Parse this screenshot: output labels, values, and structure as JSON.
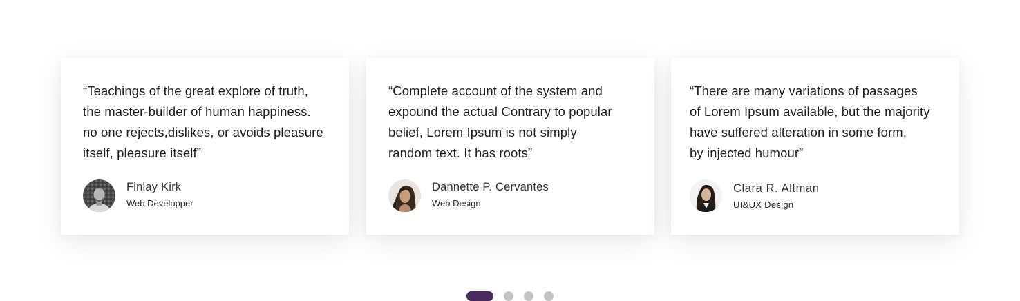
{
  "testimonials": [
    {
      "quote_lines": [
        "“Teachings of the great explore of truth,",
        "the master-builder of human happiness.",
        "no one rejects,dislikes, or avoids pleasure",
        "itself, pleasure itself”"
      ],
      "name": "Finlay Kirk",
      "role": "Web Developper"
    },
    {
      "quote_lines": [
        "“Complete account of the system and",
        "expound the actual Contrary to popular",
        "belief, Lorem Ipsum is not simply",
        "random text. It has roots”"
      ],
      "name": "Dannette P. Cervantes",
      "role": "Web Design"
    },
    {
      "quote_lines": [
        "“There are many variations of passages",
        " of Lorem Ipsum available, but the majority",
        " have suffered alteration in some form,",
        " by injected humour”"
      ],
      "name": "Clara R. Altman",
      "role": "UI&UX Design"
    }
  ],
  "pagination": {
    "active_index": 0,
    "active_color": "#4a2a5c",
    "inactive_color": "#c4c4c4"
  }
}
